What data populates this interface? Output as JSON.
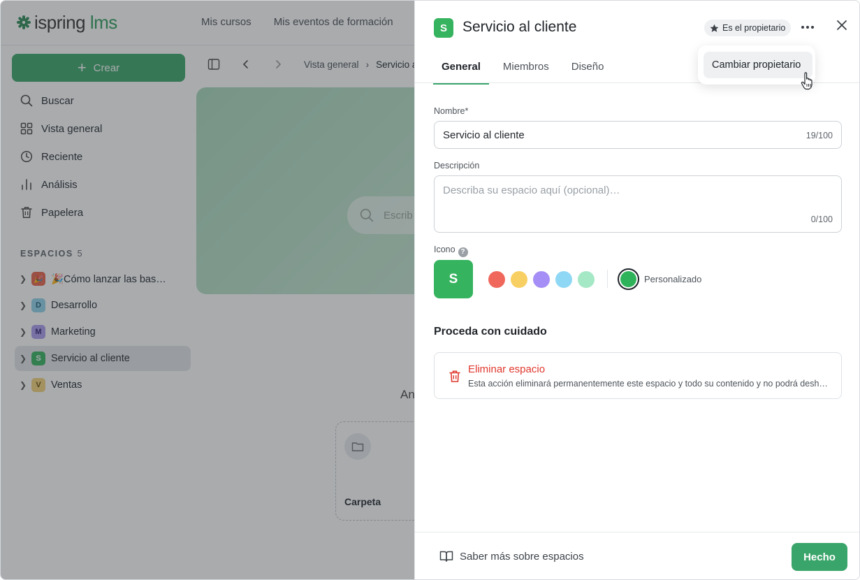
{
  "brand": {
    "name": "ispring",
    "suffix": "lms"
  },
  "topnav": [
    "Mis cursos",
    "Mis eventos de formación"
  ],
  "sidebar": {
    "create_label": "Crear",
    "items": [
      {
        "label": "Buscar",
        "icon": "search-icon"
      },
      {
        "label": "Vista general",
        "icon": "grid-icon"
      },
      {
        "label": "Reciente",
        "icon": "clock-icon"
      },
      {
        "label": "Análisis",
        "icon": "bar-chart-icon"
      },
      {
        "label": "Papelera",
        "icon": "trash-icon"
      }
    ],
    "spaces_label": "ESPACIOS",
    "spaces_count": "5",
    "spaces": [
      {
        "letter": "",
        "label": "🎉Cómo lanzar las bas…",
        "color": "#e8624b"
      },
      {
        "letter": "D",
        "label": "Desarrollo",
        "color": "#8fd3ea"
      },
      {
        "letter": "M",
        "label": "Marketing",
        "color": "#a99cf0"
      },
      {
        "letter": "S",
        "label": "Servicio al cliente",
        "color": "#36b35f"
      },
      {
        "letter": "V",
        "label": "Ventas",
        "color": "#f5d27a"
      }
    ]
  },
  "content": {
    "breadcrumb_1": "Vista general",
    "breadcrumb_2": "Servicio a",
    "search_placeholder": "Escrib",
    "partial_text": "An",
    "folder_label": "Carpeta"
  },
  "panel": {
    "icon_letter": "S",
    "title": "Servicio al cliente",
    "owner_badge": "Es el propietario",
    "menu_item": "Cambiar propietario",
    "tabs": [
      "General",
      "Miembros",
      "Diseño"
    ],
    "name_label": "Nombre*",
    "name_value": "Servicio al cliente",
    "name_count": "19/100",
    "desc_label": "Descripción",
    "desc_placeholder": "Describa su espacio aquí (opcional)…",
    "desc_count": "0/100",
    "icon_label": "Icono",
    "icon_help": "?",
    "swatches": [
      "#f0675c",
      "#f8cf62",
      "#a58ef5",
      "#8fd8f5",
      "#a5e8c5"
    ],
    "custom_label": "Personalizado",
    "careful_title": "Proceda con cuidado",
    "delete_title": "Eliminar espacio",
    "delete_desc": "Esta acción eliminará permanentemente este espacio y todo su contenido y no podrá deshacerse.",
    "learn_more": "Saber más sobre espacios",
    "done_label": "Hecho"
  }
}
